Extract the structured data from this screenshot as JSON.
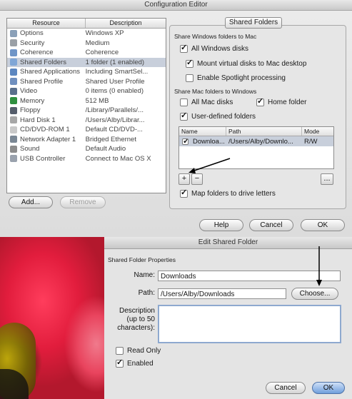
{
  "config_editor": {
    "title": "Configuration Editor",
    "resources_table": {
      "columns": [
        "Resource",
        "Description"
      ],
      "rows": [
        {
          "name": "Options",
          "description": "Windows XP",
          "icon": "options-icon",
          "color": "#8aa0b8"
        },
        {
          "name": "Security",
          "description": "Medium",
          "icon": "security-icon",
          "color": "#9aa0a6"
        },
        {
          "name": "Coherence",
          "description": "Coherence",
          "icon": "coherence-icon",
          "color": "#6f95c7"
        },
        {
          "name": "Shared Folders",
          "description": "1 folder (1 enabled)",
          "icon": "shared-folders-icon",
          "color": "#7fa6d6",
          "selected": true
        },
        {
          "name": "Shared Applications",
          "description": "Including SmartSel...",
          "icon": "shared-applications-icon",
          "color": "#5b86c0"
        },
        {
          "name": "Shared Profile",
          "description": "Shared User Profile",
          "icon": "shared-profile-icon",
          "color": "#6f8fbf"
        },
        {
          "name": "Video",
          "description": "0 items (0 enabled)",
          "icon": "video-icon",
          "color": "#5a6f8c"
        },
        {
          "name": "Memory",
          "description": "512 MB",
          "icon": "memory-icon",
          "color": "#2f8f3f"
        },
        {
          "name": "Floppy",
          "description": "/Library/Parallels/...",
          "icon": "floppy-icon",
          "color": "#555d6b"
        },
        {
          "name": "Hard Disk 1",
          "description": "/Users/Alby/Librar...",
          "icon": "hard-disk-icon",
          "color": "#a7a7a7"
        },
        {
          "name": "CD/DVD-ROM 1",
          "description": "Default CD/DVD-...",
          "icon": "cd-dvd-icon",
          "color": "#c9c9c9"
        },
        {
          "name": "Network Adapter 1",
          "description": "Bridged Ethernet",
          "icon": "network-adapter-icon",
          "color": "#7a8794"
        },
        {
          "name": "Sound",
          "description": "Default Audio",
          "icon": "sound-icon",
          "color": "#8c8c8c"
        },
        {
          "name": "USB Controller",
          "description": "Connect to Mac OS X",
          "icon": "usb-controller-icon",
          "color": "#9aa2ad"
        }
      ]
    },
    "add_button": "Add...",
    "remove_button": "Remove",
    "tab_label": "Shared Folders",
    "windows_section_label": "Share Windows folders to Mac",
    "all_windows_disks": {
      "label": "All Windows disks",
      "checked": true
    },
    "mount_virtual_disks": {
      "label": "Mount virtual disks to Mac desktop",
      "checked": true
    },
    "enable_spotlight": {
      "label": "Enable Spotlight processing",
      "checked": false
    },
    "mac_section_label": "Share Mac folders to Windows",
    "all_mac_disks": {
      "label": "All Mac disks",
      "checked": false
    },
    "home_folder": {
      "label": "Home folder",
      "checked": true
    },
    "user_defined_folders": {
      "label": "User-defined folders",
      "checked": true
    },
    "folders_table": {
      "columns": [
        "Name",
        "Path",
        "Mode"
      ],
      "row": {
        "checked": true,
        "name": "Downloa...",
        "path": "/Users/Alby/Downlo...",
        "mode": "R/W"
      }
    },
    "plus_label": "+",
    "minus_label": "−",
    "more_label": "...",
    "map_folders": {
      "label": "Map folders to drive letters",
      "checked": true
    },
    "help_button": "Help",
    "cancel_button": "Cancel",
    "ok_button": "OK"
  },
  "edit_shared_folder": {
    "title": "Edit Shared Folder",
    "section_label": "Shared Folder Properties",
    "name_label": "Name:",
    "name_value": "Downloads",
    "path_label": "Path:",
    "path_value": "/Users/Alby/Downloads",
    "choose_button": "Choose...",
    "description_label_1": "Description",
    "description_label_2": "(up to 50",
    "description_label_3": "characters):",
    "description_value": "",
    "read_only": {
      "label": "Read Only",
      "checked": false
    },
    "enabled": {
      "label": "Enabled",
      "checked": true
    },
    "cancel_button": "Cancel",
    "ok_button": "OK"
  }
}
